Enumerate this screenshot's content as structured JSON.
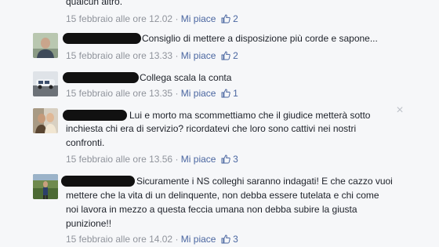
{
  "top_fragment": "qualcun altro.",
  "ui": {
    "like_label": "Mi piace",
    "separator": "·",
    "close_symbol": "×"
  },
  "comments": [
    {
      "timestamp": "15 febbraio alle ore 12.02",
      "like_count": "2"
    },
    {
      "text": "Consiglio di mettere a disposizione più corde e sapone...",
      "timestamp": "15 febbraio alle ore 13.33",
      "like_count": "2"
    },
    {
      "text": "Collega scala la conta",
      "timestamp": "15 febbraio alle ore 13.35",
      "like_count": "1"
    },
    {
      "lines": [
        "Lui e morto ma scommettiamo che il giudice metterà sotto",
        "inchiesta chi era di servizio? ricordatevi che loro sono cattivi nei nostri",
        "confronti."
      ],
      "timestamp": "15 febbraio alle ore 13.56",
      "like_count": "3"
    },
    {
      "lines": [
        "Sicuramente i NS colleghi saranno indagati! E che cazzo vuoi",
        "mettere che la vita di un delinquente, non debba essere tutelata e chi come",
        "noi lavora in mezzo a questa feccia umana non debba subire la giusta",
        "punizione!!"
      ],
      "timestamp": "15 febbraio alle ore 14.02",
      "like_count": "3"
    }
  ]
}
